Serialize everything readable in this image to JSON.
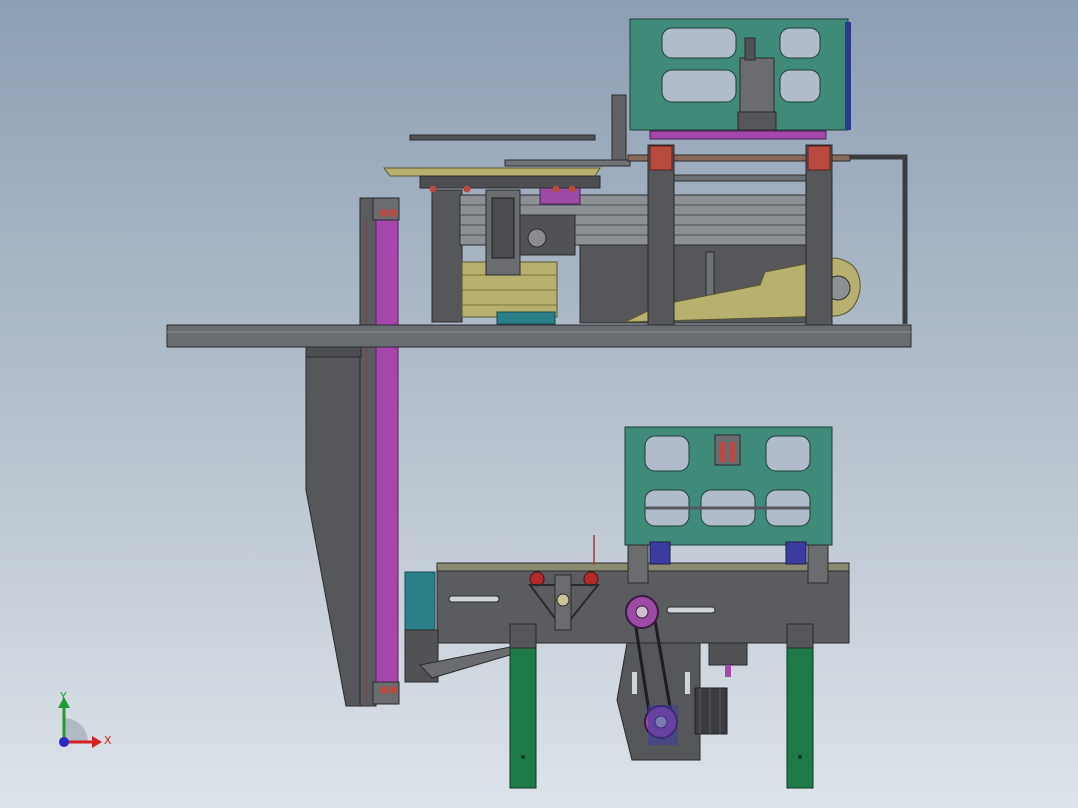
{
  "triad": {
    "x_label": "X",
    "y_label": "Y",
    "x_color": "#d42020",
    "y_color": "#1e9a2e",
    "z_color": "#2828c8"
  },
  "colors": {
    "steel": "#56585c",
    "steel_light": "#6f7277",
    "frame_teal": "#3f8a78",
    "leg_green": "#1e7a48",
    "magenta": "#a040a8",
    "olive": "#b8b070",
    "motor_teal": "#2b7e86",
    "red_part": "#b43a36",
    "blue_motor": "#3c3ca0"
  },
  "parts": [
    "main-base-plate",
    "upper-gantry-frame",
    "upper-slide-assembly",
    "vertical-lift-column",
    "lower-conveyor-module",
    "lower-gantry-frame",
    "belt-drive",
    "support-legs",
    "coordinate-triad"
  ]
}
